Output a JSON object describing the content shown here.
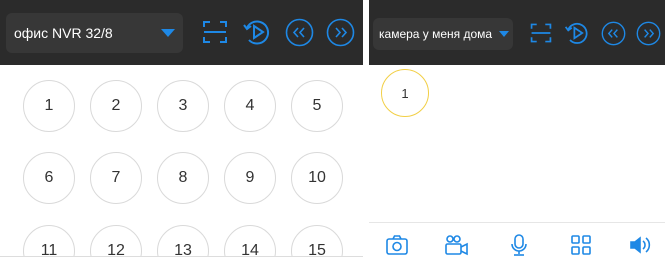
{
  "colors": {
    "topbar": "#2b2b2b",
    "accent": "#1e88e5",
    "selected_ring": "#f2cf45",
    "ring": "#d9d9d9"
  },
  "left_panel": {
    "device_select": {
      "value": "офис NVR 32/8"
    },
    "toolbar": {
      "icons": [
        "fullscreen-icon",
        "playback-icon",
        "previous-page-icon",
        "next-page-icon"
      ]
    },
    "channels": [
      "1",
      "2",
      "3",
      "4",
      "5",
      "6",
      "7",
      "8",
      "9",
      "10",
      "11",
      "12",
      "13",
      "14",
      "15"
    ]
  },
  "right_panel": {
    "device_select": {
      "value": "камера у меня дома"
    },
    "toolbar": {
      "icons": [
        "fullscreen-icon",
        "playback-icon",
        "previous-page-icon",
        "next-page-icon"
      ]
    },
    "channels": [
      "1"
    ],
    "selected_channel": "1",
    "bottom_toolbar": {
      "icons": [
        "snapshot-icon",
        "record-icon",
        "microphone-icon",
        "layout-grid-icon",
        "speaker-icon"
      ]
    }
  }
}
